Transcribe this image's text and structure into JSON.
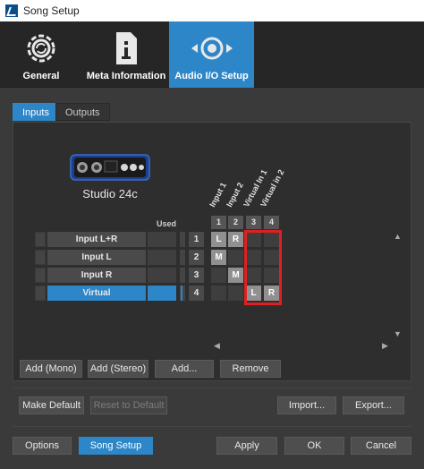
{
  "window": {
    "title": "Song Setup"
  },
  "header": {
    "tabs": [
      {
        "label": "General",
        "icon": "gear-refresh-icon"
      },
      {
        "label": "Meta Information",
        "icon": "info-document-icon"
      },
      {
        "label": "Audio I/O Setup",
        "icon": "audio-io-icon",
        "active": true
      }
    ]
  },
  "io_tabs": [
    {
      "label": "Inputs",
      "active": true
    },
    {
      "label": "Outputs"
    }
  ],
  "device": {
    "name": "Studio 24c"
  },
  "matrix": {
    "used_header": "Used",
    "columns": [
      {
        "name": "Input 1",
        "num": "1"
      },
      {
        "name": "Input 2",
        "num": "2"
      },
      {
        "name": "Virtual In 1",
        "num": "3"
      },
      {
        "name": "Virtual in 2",
        "num": "4"
      }
    ],
    "rows": [
      {
        "label": "Input L+R",
        "num": "1",
        "cells": [
          "L",
          "R",
          "",
          ""
        ]
      },
      {
        "label": "Input L",
        "num": "2",
        "cells": [
          "M",
          "",
          "",
          ""
        ]
      },
      {
        "label": "Input R",
        "num": "3",
        "cells": [
          "",
          "M",
          "",
          ""
        ]
      },
      {
        "label": "Virtual",
        "num": "4",
        "cells": [
          "",
          "",
          "L",
          "R"
        ],
        "selected": true
      }
    ]
  },
  "panel_buttons": {
    "add_mono": "Add (Mono)",
    "add_stereo": "Add (Stereo)",
    "add": "Add...",
    "remove": "Remove"
  },
  "default_row": {
    "make_default": "Make Default",
    "reset_default": "Reset to Default",
    "import": "Import...",
    "export": "Export..."
  },
  "footer": {
    "options": "Options",
    "song_setup": "Song Setup",
    "apply": "Apply",
    "ok": "OK",
    "cancel": "Cancel"
  },
  "colors": {
    "accent": "#2d86c8",
    "highlight": "#e02020"
  }
}
